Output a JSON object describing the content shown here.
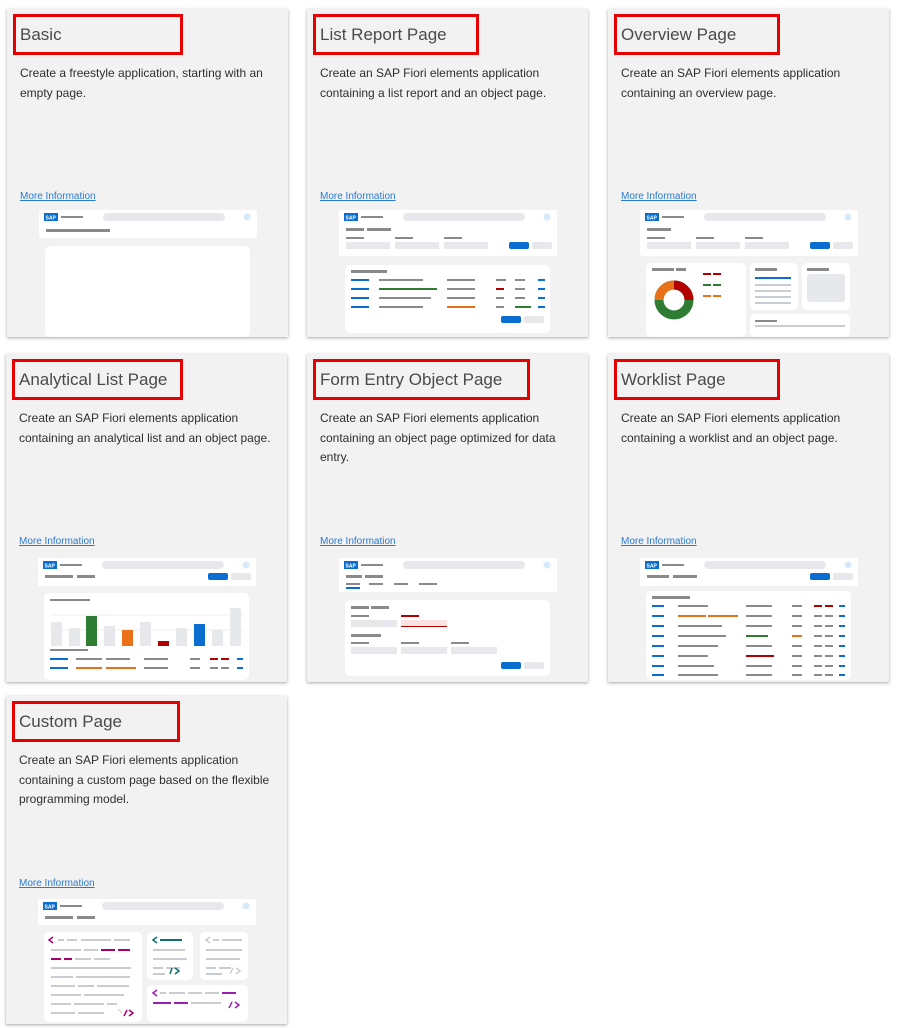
{
  "cards": [
    {
      "title": "Basic",
      "description": "Create a freestyle application, starting with an empty page.",
      "more": "More Information",
      "logo": "SAP"
    },
    {
      "title": "List Report Page",
      "description": "Create an SAP Fiori elements application containing a list report and an object page.",
      "more": "More Information",
      "logo": "SAP"
    },
    {
      "title": "Overview Page",
      "description": "Create an SAP Fiori elements application containing an overview page.",
      "more": "More Information",
      "logo": "SAP"
    },
    {
      "title": "Analytical List Page",
      "description": "Create an SAP Fiori elements application containing an analytical list and an object page.",
      "more": "More Information",
      "logo": "SAP"
    },
    {
      "title": "Form Entry Object Page",
      "description": "Create an SAP Fiori elements application containing an object page optimized for data entry.",
      "more": "More Information",
      "logo": "SAP"
    },
    {
      "title": "Worklist Page",
      "description": "Create an SAP Fiori elements application containing a worklist and an object page.",
      "more": "More Information",
      "logo": "SAP"
    },
    {
      "title": "Custom Page",
      "description": "Create an SAP Fiori elements application containing a custom page based on the flexible programming model.",
      "more": "More Information",
      "logo": "SAP"
    }
  ],
  "colors": {
    "highlight": "#e60000",
    "link": "#2b7ad1",
    "sap_blue": "#0a6ed1",
    "green": "#2e7d32",
    "orange": "#e8711a",
    "red": "#b20000",
    "magenta": "#a8006f",
    "teal": "#0f6e6e",
    "purple": "#9b1fb5"
  }
}
